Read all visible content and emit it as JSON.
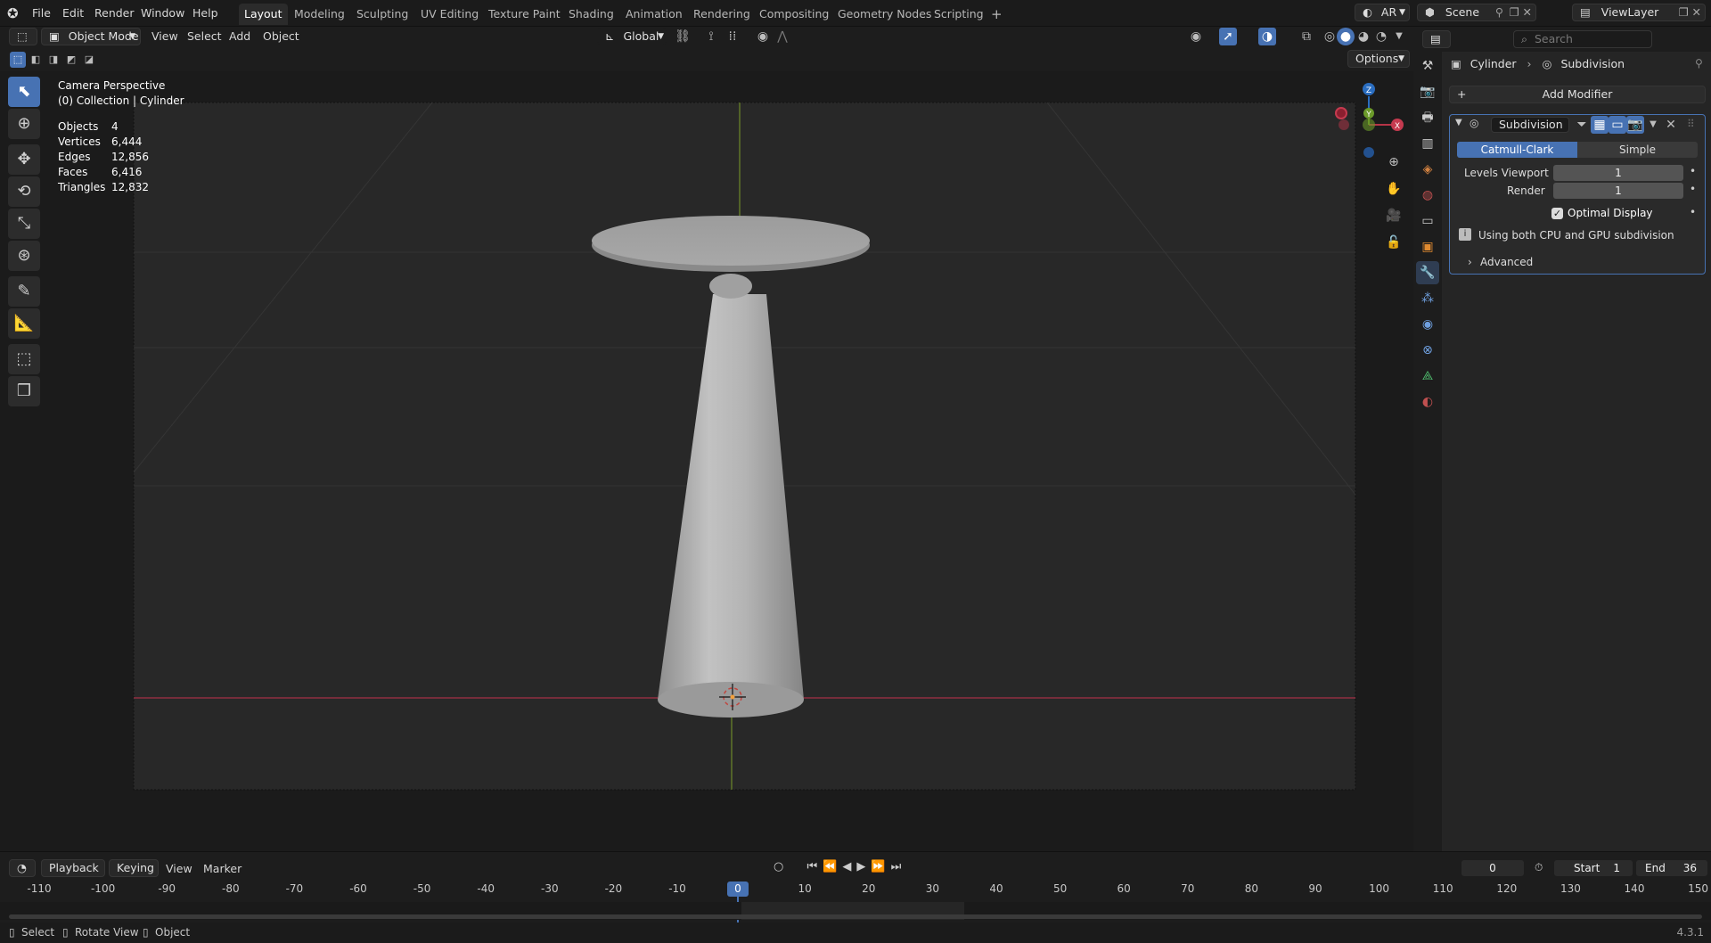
{
  "menubar": {
    "items": [
      "File",
      "Edit",
      "Render",
      "Window",
      "Help"
    ],
    "workspaces": [
      "Layout",
      "Modeling",
      "Sculpting",
      "UV Editing",
      "Texture Paint",
      "Shading",
      "Animation",
      "Rendering",
      "Compositing",
      "Geometry Nodes",
      "Scripting"
    ],
    "active_workspace": "Layout",
    "engine_label": "AR",
    "scene_name": "Scene",
    "view_layer": "ViewLayer"
  },
  "viewport_header": {
    "mode": "Object Mode",
    "menus": [
      "View",
      "Select",
      "Add",
      "Object"
    ],
    "transform_orientation": "Global",
    "options_label": "Options"
  },
  "overlay": {
    "view_name": "Camera Perspective",
    "collection": "(0) Collection | Cylinder",
    "stats": [
      {
        "label": "Objects",
        "value": "4"
      },
      {
        "label": "Vertices",
        "value": "6,444"
      },
      {
        "label": "Edges",
        "value": "12,856"
      },
      {
        "label": "Faces",
        "value": "6,416"
      },
      {
        "label": "Triangles",
        "value": "12,832"
      }
    ]
  },
  "gizmo": {
    "x": "X",
    "y": "Y",
    "z": "Z"
  },
  "properties": {
    "search_placeholder": "Search",
    "breadcrumb_object": "Cylinder",
    "breadcrumb_modifier": "Subdivision",
    "add_modifier": "Add Modifier",
    "modifier": {
      "name": "Subdivision",
      "type_options": [
        "Catmull-Clark",
        "Simple"
      ],
      "selected_type": "Catmull-Clark",
      "levels_viewport_label": "Levels Viewport",
      "levels_viewport": "1",
      "render_label": "Render",
      "render_value": "1",
      "optimal_display_label": "Optimal Display",
      "optimal_display_checked": true,
      "info_text": "Using both CPU and GPU subdivision",
      "advanced_label": "Advanced"
    }
  },
  "timeline": {
    "menus": [
      "Playback",
      "Keying",
      "View",
      "Marker"
    ],
    "current_frame": "0",
    "start_label": "Start",
    "start_value": "1",
    "end_label": "End",
    "end_value": "36",
    "ticks": [
      "-110",
      "-100",
      "-90",
      "-80",
      "-70",
      "-60",
      "-50",
      "-40",
      "-30",
      "-20",
      "-10",
      "0",
      "10",
      "20",
      "30",
      "40",
      "50",
      "60",
      "70",
      "80",
      "90",
      "100",
      "110",
      "120",
      "130",
      "140",
      "150"
    ]
  },
  "statusbar": {
    "select": "Select",
    "rotate": "Rotate View",
    "object": "Object",
    "version": "4.3.1"
  }
}
